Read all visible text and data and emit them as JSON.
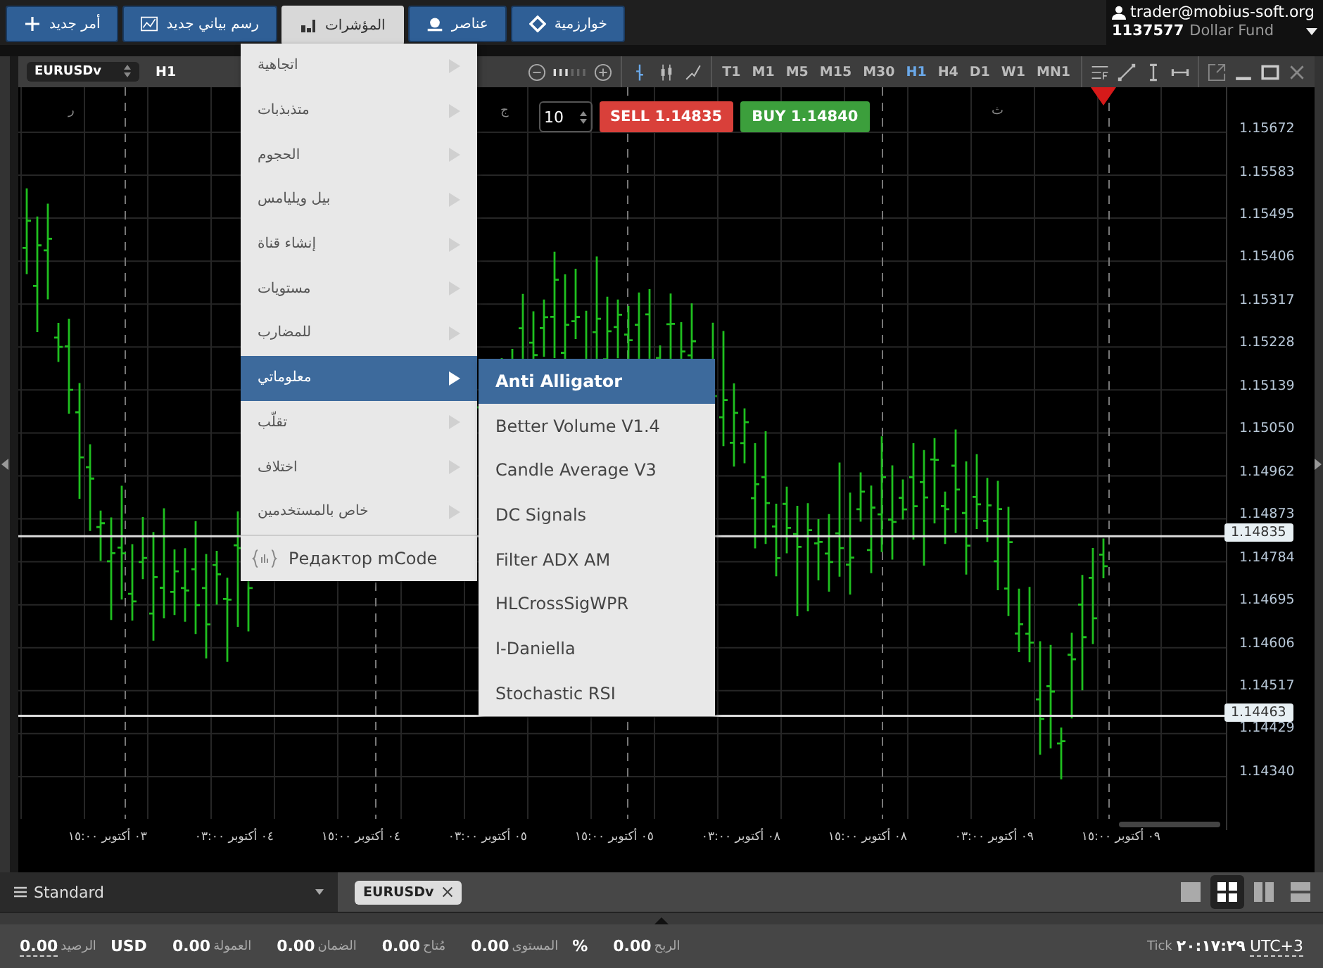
{
  "top_tabs": [
    {
      "label": "خوارزمية",
      "kind": "diamond",
      "selected": false
    },
    {
      "label": "عناصر",
      "kind": "shapes",
      "selected": false
    },
    {
      "label": "المؤشرات",
      "kind": "bars",
      "selected": true
    },
    {
      "label": "رسم بياني جديد",
      "kind": "chart",
      "selected": false
    },
    {
      "label": "أمر جديد",
      "kind": "plus",
      "selected": false
    }
  ],
  "account": {
    "email": "trader@mobius-soft.org",
    "number": "1137577",
    "name": "Dollar Fund"
  },
  "chart_window": {
    "symbol": "EURUSDv",
    "timeframe": "H1",
    "timeframes": [
      {
        "label": "MN1",
        "selected": false
      },
      {
        "label": "W1",
        "selected": false
      },
      {
        "label": "D1",
        "selected": false
      },
      {
        "label": "H4",
        "selected": false
      },
      {
        "label": "H1",
        "selected": true
      },
      {
        "label": "M30",
        "selected": false
      },
      {
        "label": "M15",
        "selected": false
      },
      {
        "label": "M5",
        "selected": false
      },
      {
        "label": "M1",
        "selected": false
      },
      {
        "label": "T1",
        "selected": false
      }
    ]
  },
  "trade": {
    "volume": "10",
    "sell": "SELL 1.14835",
    "buy": "BUY 1.14840"
  },
  "chart": {
    "day_marks": [
      "ث",
      "ج",
      "ر"
    ],
    "price_ticks": [
      "1.15672",
      "1.15583",
      "1.15495",
      "1.15406",
      "1.15317",
      "1.15228",
      "1.15139",
      "1.15050",
      "1.14962",
      "1.14873",
      "1.14784",
      "1.14695",
      "1.14606",
      "1.14517",
      "1.14429",
      "1.14340"
    ],
    "price_lines": [
      "1.14835",
      "1.14463"
    ],
    "time_labels": [
      "٠٩ أكتوبر ١٥:٠٠",
      "٠٩ أكتوبر ٠٣:٠٠",
      "٠٨ أكتوبر ١٥:٠٠",
      "٠٨ أكتوبر ٠٣:٠٠",
      "٠٥ أكتوبر ١٥:٠٠",
      "٠٥ أكتوبر ٠٣:٠٠",
      "٠٤ أكتوبر ١٥:٠٠",
      "٠٤ أكتوبر ٠٣:٠٠",
      "٠٣ أكتوبر ١٥:٠٠"
    ]
  },
  "indicators_menu": {
    "items": [
      {
        "label": "اتجاهية",
        "selected": false
      },
      {
        "label": "متذبذبات",
        "selected": false
      },
      {
        "label": "الحجوم",
        "selected": false
      },
      {
        "label": "بيل ويليامس",
        "selected": false
      },
      {
        "label": "إنشاء قناة",
        "selected": false
      },
      {
        "label": "مستويات",
        "selected": false
      },
      {
        "label": "للمضارب",
        "selected": false
      },
      {
        "label": "معلوماتي",
        "selected": true
      },
      {
        "label": "تقلّب",
        "selected": false
      },
      {
        "label": "اختلاف",
        "selected": false
      },
      {
        "label": "خاص بالمستخدمين",
        "selected": false
      }
    ],
    "footer": "Редактор mCode"
  },
  "submenu": {
    "items": [
      {
        "label": "Anti Alligator",
        "selected": true
      },
      {
        "label": "Better Volume V1.4",
        "selected": false
      },
      {
        "label": "Candle Average V3",
        "selected": false
      },
      {
        "label": "DC Signals",
        "selected": false
      },
      {
        "label": "Filter ADX AM",
        "selected": false
      },
      {
        "label": "HLCrossSigWPR",
        "selected": false
      },
      {
        "label": "I-Daniella",
        "selected": false
      },
      {
        "label": "Stochastic RSI",
        "selected": false
      }
    ]
  },
  "bottom_bar": {
    "workspace": "Standard",
    "chart_tabs": [
      {
        "label": "EURUSDv"
      }
    ],
    "layouts": [
      {
        "kind": "single",
        "selected": false
      },
      {
        "kind": "grid",
        "selected": true
      },
      {
        "kind": "columns",
        "selected": false
      },
      {
        "kind": "rows",
        "selected": false
      }
    ]
  },
  "status_bar": {
    "fields": [
      {
        "value": "0.00",
        "label": "الربح"
      },
      {
        "value": "0.00",
        "label": "المستوى",
        "unit": "%"
      },
      {
        "value": "0.00",
        "label": "مُتاح"
      },
      {
        "value": "0.00",
        "label": "الضمان"
      },
      {
        "value": "0.00",
        "label": "العمولة"
      },
      {
        "value": "0.00",
        "label": "الرصيد",
        "unit": "USD"
      }
    ],
    "clock_label": "Tick",
    "time": "٢٠:١٧:٢٩",
    "timezone": "UTC+3"
  }
}
